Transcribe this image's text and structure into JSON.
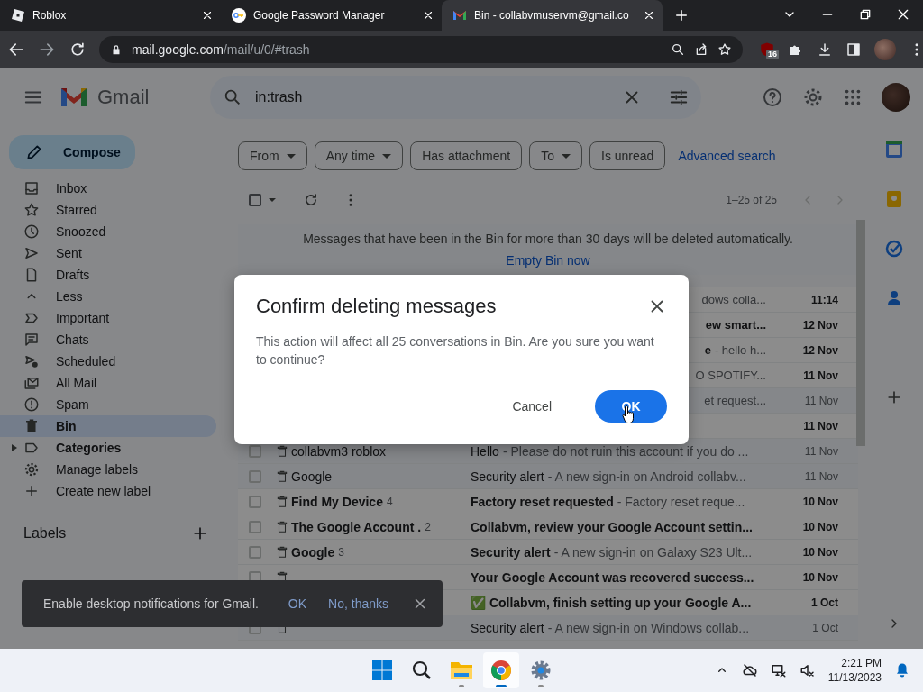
{
  "browser": {
    "tabs": [
      {
        "title": "Roblox",
        "selected": false
      },
      {
        "title": "Google Password Manager",
        "selected": false
      },
      {
        "title": "Bin - collabvmuservm@gmail.co",
        "selected": true
      }
    ],
    "address": {
      "host": "mail.google.com",
      "path": "/mail/u/0/#trash"
    },
    "extension_badge": "16"
  },
  "gmail": {
    "product_name": "Gmail",
    "search": {
      "value": "in:trash"
    },
    "compose": "Compose",
    "nav": [
      {
        "label": "Inbox",
        "selected": false,
        "bold": false,
        "expandable": false
      },
      {
        "label": "Starred",
        "selected": false,
        "bold": false,
        "expandable": false
      },
      {
        "label": "Snoozed",
        "selected": false,
        "bold": false,
        "expandable": false
      },
      {
        "label": "Sent",
        "selected": false,
        "bold": false,
        "expandable": false
      },
      {
        "label": "Drafts",
        "selected": false,
        "bold": false,
        "expandable": false
      },
      {
        "label": "Less",
        "selected": false,
        "bold": false,
        "expandable": false
      },
      {
        "label": "Important",
        "selected": false,
        "bold": false,
        "expandable": false
      },
      {
        "label": "Chats",
        "selected": false,
        "bold": false,
        "expandable": false
      },
      {
        "label": "Scheduled",
        "selected": false,
        "bold": false,
        "expandable": false
      },
      {
        "label": "All Mail",
        "selected": false,
        "bold": false,
        "expandable": false
      },
      {
        "label": "Spam",
        "selected": false,
        "bold": false,
        "expandable": false
      },
      {
        "label": "Bin",
        "selected": true,
        "bold": true,
        "expandable": false
      },
      {
        "label": "Categories",
        "selected": false,
        "bold": true,
        "expandable": true
      },
      {
        "label": "Manage labels",
        "selected": false,
        "bold": false,
        "expandable": false
      },
      {
        "label": "Create new label",
        "selected": false,
        "bold": false,
        "expandable": false
      }
    ],
    "labels_heading": "Labels",
    "filters": [
      {
        "label": "From",
        "dropdown": true
      },
      {
        "label": "Any time",
        "dropdown": true
      },
      {
        "label": "Has attachment",
        "dropdown": false
      },
      {
        "label": "To",
        "dropdown": true
      },
      {
        "label": "Is unread",
        "dropdown": false
      }
    ],
    "advanced_search": "Advanced search",
    "select_all": {
      "checked": false
    },
    "pagination": "1–25 of 25",
    "bin_notice": "Messages that have been in the Bin for more than 30 days will be deleted automatically.",
    "empty_bin": "Empty Bin now",
    "rows": [
      {
        "kind": "covered",
        "snippet": "dows colla...",
        "date": "11:14",
        "unread": true
      },
      {
        "kind": "covered",
        "subject": "ew smart...",
        "date": "12 Nov",
        "unread": true
      },
      {
        "kind": "covered",
        "subject": "e",
        "snippet": "- hello h...",
        "date": "12 Nov",
        "unread": true
      },
      {
        "kind": "covered",
        "snippet": "O SPOTIFY...",
        "date": "11 Nov",
        "unread": true
      },
      {
        "kind": "covered",
        "snippet": "et request...",
        "date": "11 Nov",
        "unread": false
      },
      {
        "kind": "covered",
        "date": "11 Nov",
        "unread": true
      },
      {
        "kind": "full",
        "sender": "collabvm3 roblox",
        "subject": "Hello",
        "snippet": "- Please do not ruin this account if you do ...",
        "date": "11 Nov",
        "unread": false
      },
      {
        "kind": "full",
        "sender": "Google",
        "subject": "Security alert",
        "snippet": "- A new sign-in on Android collabv...",
        "date": "11 Nov",
        "unread": false
      },
      {
        "kind": "full",
        "sender": "Find My Device",
        "count": "4",
        "subject": "Factory reset requested",
        "snippet": "- Factory reset reque...",
        "date": "10 Nov",
        "unread": true
      },
      {
        "kind": "full",
        "sender": "The Google Account .",
        "count": "2",
        "subject": "Collabvm, review your Google Account settin...",
        "date": "10 Nov",
        "unread": true
      },
      {
        "kind": "full",
        "sender": "Google",
        "count": "3",
        "subject": "Security alert",
        "snippet": "- A new sign-in on Galaxy S23 Ult...",
        "date": "10 Nov",
        "unread": true
      },
      {
        "kind": "full",
        "subject": "Your Google Account was recovered success...",
        "date": "10 Nov",
        "unread": true
      },
      {
        "kind": "under_snackbar",
        "subject": "✅ Collabvm, finish setting up your Google A...",
        "date": "1 Oct",
        "unread": true
      },
      {
        "kind": "full",
        "subject": "Security alert",
        "snippet": "- A new sign-in on Windows collab...",
        "date": "1 Oct",
        "unread": false
      }
    ]
  },
  "dialog": {
    "title": "Confirm deleting messages",
    "message": "This action will affect all 25 conversations in Bin. Are you sure you want to continue?",
    "buttons": [
      {
        "label": "Cancel",
        "kind": "text"
      },
      {
        "label": "OK",
        "kind": "primary"
      }
    ]
  },
  "snackbar": {
    "message": "Enable desktop notifications for Gmail.",
    "actions": [
      "OK",
      "No, thanks"
    ]
  },
  "taskbar": {
    "time": "2:21 PM",
    "date": "11/13/2023",
    "apps": [
      {
        "running": false,
        "selected": false
      },
      {
        "running": false,
        "selected": false
      },
      {
        "running": true,
        "selected": false
      },
      {
        "running": true,
        "selected": true
      },
      {
        "running": true,
        "selected": false
      }
    ]
  }
}
